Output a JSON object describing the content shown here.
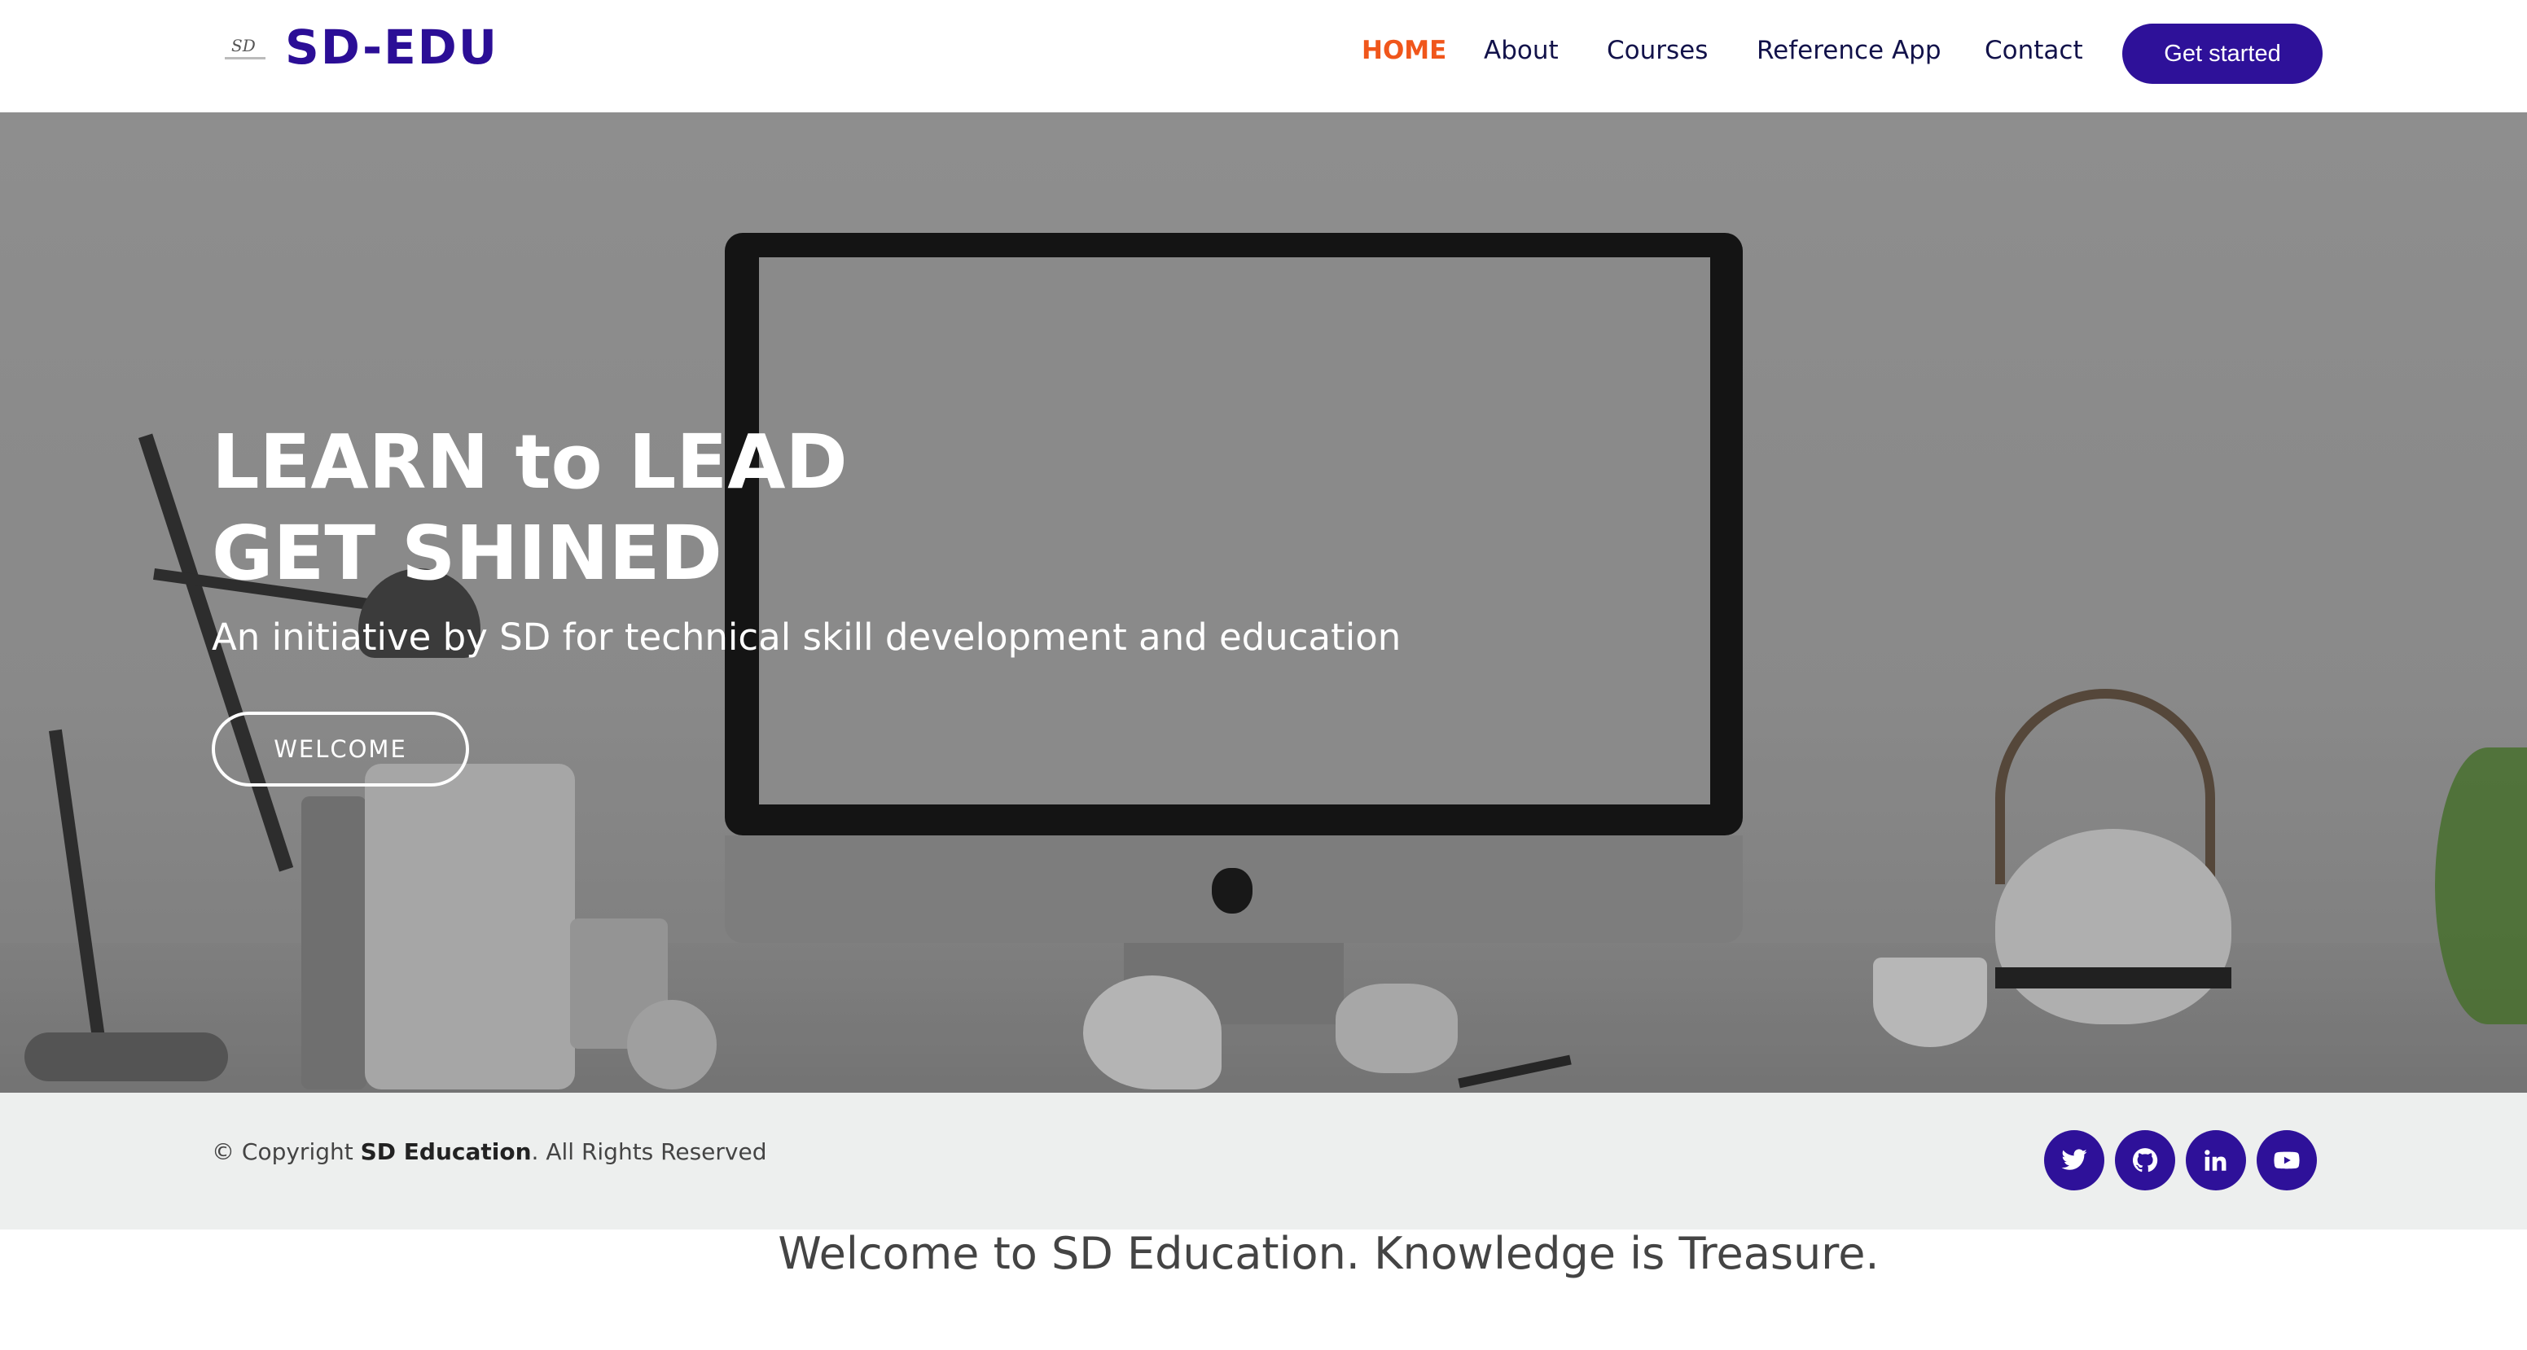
{
  "header": {
    "brand": "SD-EDU",
    "logo_mark_text": "SD",
    "nav": [
      {
        "label": "HOME",
        "active": true
      },
      {
        "label": "About",
        "active": false
      },
      {
        "label": "Courses",
        "active": false
      },
      {
        "label": "Reference App",
        "active": false
      },
      {
        "label": "Contact",
        "active": false
      }
    ],
    "cta_label": "Get started"
  },
  "hero": {
    "title_line1": "LEARN to LEAD",
    "title_line2": "GET SHINED",
    "subtitle": "An initiative by SD for technical skill development and education",
    "button_label": "WELCOME"
  },
  "footer": {
    "copyright_prefix": "© Copyright",
    "copyright_brand": "SD Education",
    "copyright_suffix": ". All Rights Reserved",
    "social": [
      "twitter-icon",
      "github-icon",
      "linkedin-icon",
      "youtube-icon"
    ]
  },
  "welcome_text": "Welcome to SD Education. Knowledge is Treasure.",
  "colors": {
    "brand": "#2b0e96",
    "accent": "#f0561b",
    "footer_bg": "#edefee"
  }
}
